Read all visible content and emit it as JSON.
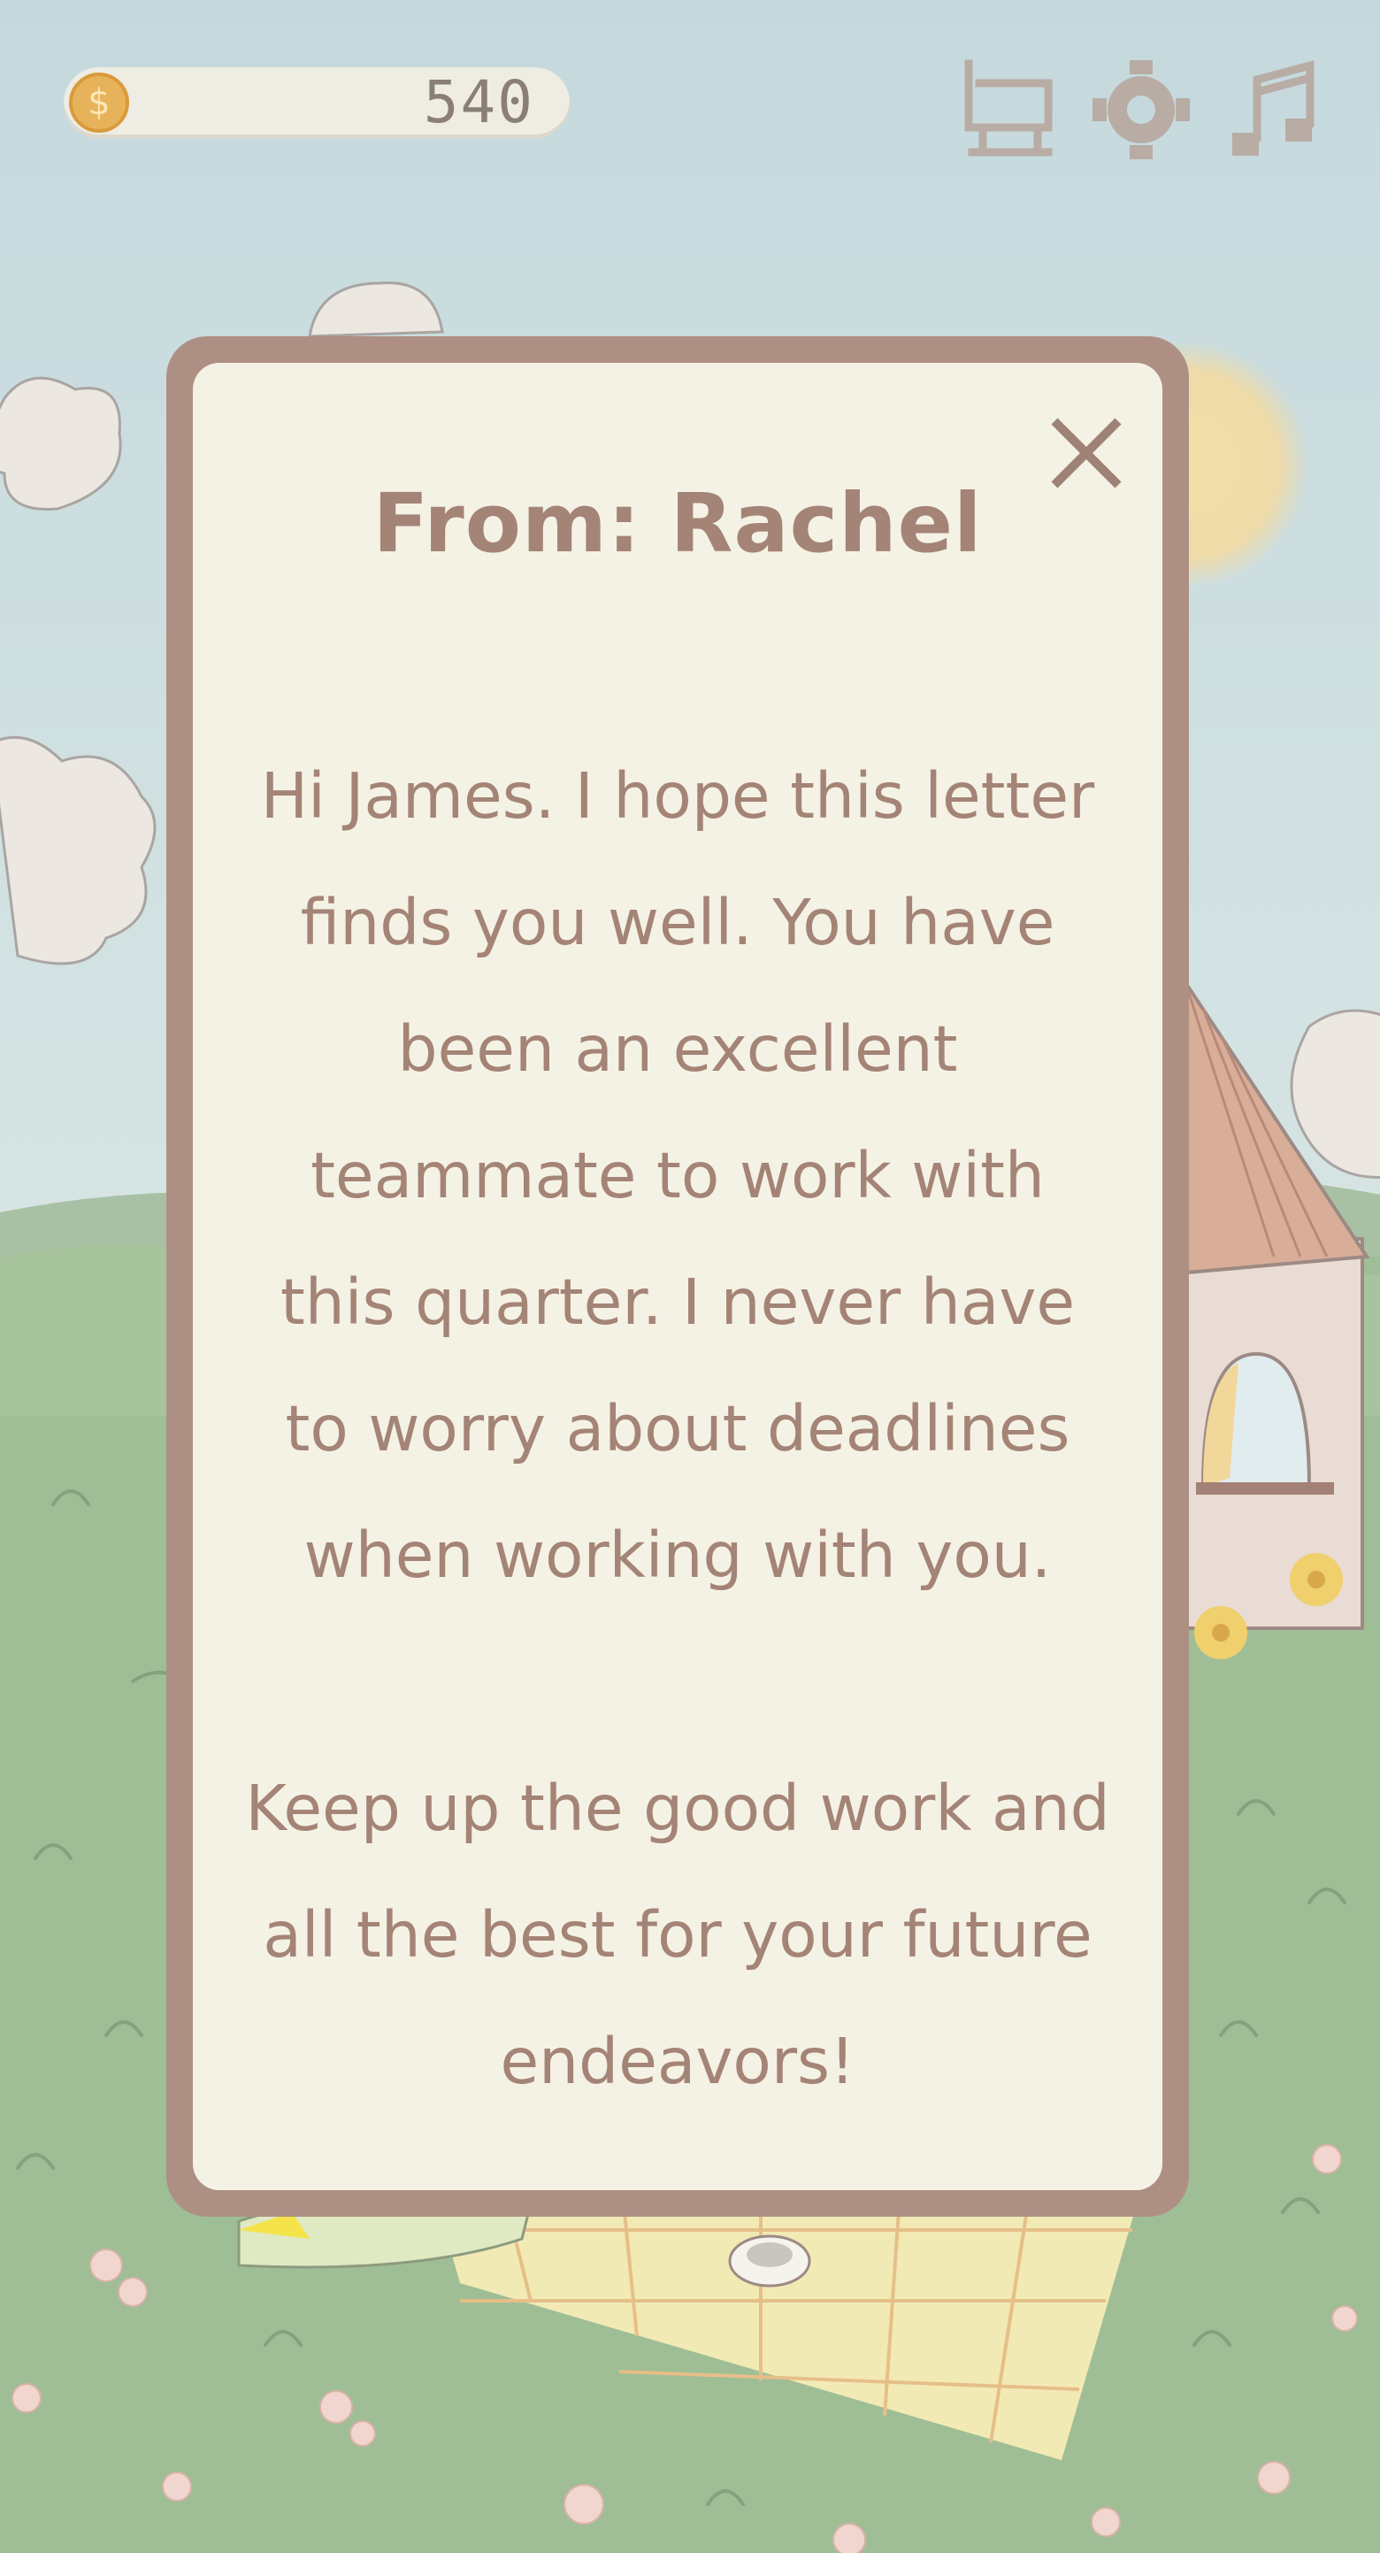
{
  "hud": {
    "coins": "540",
    "coin_symbol": "$"
  },
  "letter": {
    "title": "From: Rachel",
    "body": "Hi James. I hope this letter\nfinds you well. You have\nbeen an excellent\nteammate to work with\nthis quarter. I never have\nto worry about deadlines\nwhen working with you.\n\nKeep up the good work and\nall the best for your future\nendeavors!",
    "close_icon": "close-icon"
  },
  "icons": {
    "shop": "shop-cart-icon",
    "settings": "gear-icon",
    "music": "music-note-icon"
  },
  "colors": {
    "frame": "#ad9083",
    "paper": "#f4f2e5",
    "text": "#a48476",
    "hud_icon": "#b8aca4"
  }
}
